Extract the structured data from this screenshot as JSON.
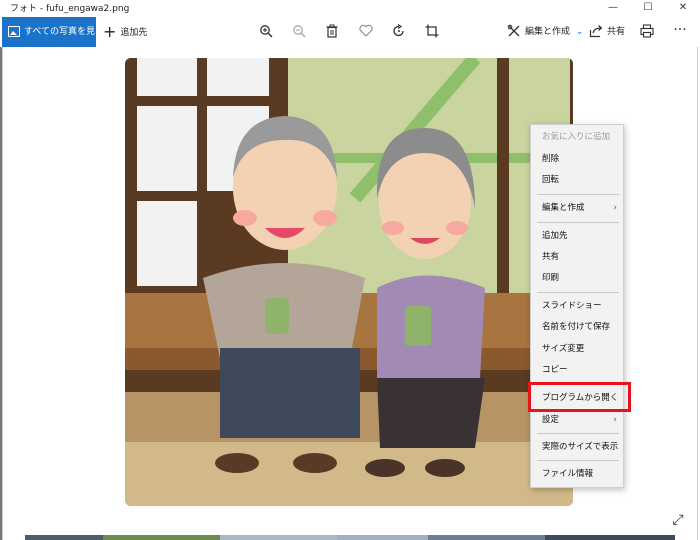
{
  "window": {
    "title": "フォト - fufu_engawa2.png",
    "controls": {
      "minimize": "—",
      "maximize": "☐",
      "close": "✕"
    }
  },
  "toolbar": {
    "all_photos_label": "すべての写真を見る",
    "add_to_label": "追加先",
    "edit_create_label": "編集と作成",
    "share_label": "共有",
    "icons": [
      "zoom-in-icon",
      "zoom-out-icon",
      "delete-icon",
      "heart-icon",
      "rotate-icon",
      "crop-icon",
      "edit-create-icon",
      "share-icon",
      "print-icon",
      "more-icon"
    ]
  },
  "context_menu": {
    "items": [
      {
        "label": "お気に入りに追加",
        "disabled": true
      },
      {
        "label": "削除"
      },
      {
        "label": "回転"
      },
      {
        "label": "編集と作成",
        "submenu": true
      },
      {
        "label": "追加先"
      },
      {
        "label": "共有"
      },
      {
        "label": "印刷"
      },
      {
        "label": "スライドショー"
      },
      {
        "label": "名前を付けて保存"
      },
      {
        "label": "サイズ変更"
      },
      {
        "label": "コピー"
      },
      {
        "label": "プログラムから開く",
        "highlighted": true
      },
      {
        "label": "設定",
        "submenu": true
      },
      {
        "label": "実際のサイズで表示"
      },
      {
        "label": "ファイル情報"
      }
    ]
  },
  "colors": {
    "accent": "#1a73c9",
    "highlight_box": "#e8141c",
    "menu_bg": "#f2f2f2"
  }
}
